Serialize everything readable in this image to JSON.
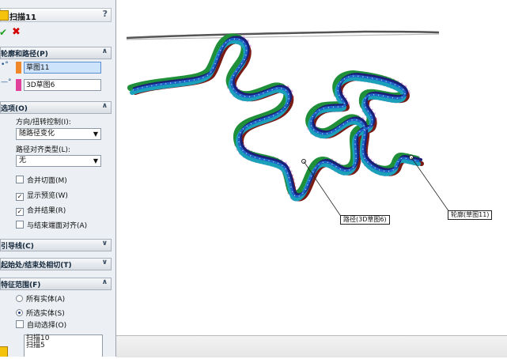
{
  "panel": {
    "title": "扫描11",
    "help": "?",
    "ok": "✔",
    "cancel": "✖",
    "sections": {
      "profile_path": "轮廓和路径(P)",
      "options": "选项(O)",
      "guides": "引导线(C)",
      "tangency": "起始处/结束处相切(T)",
      "scope": "特征范围(F)"
    },
    "profile_field": "草图11",
    "path_field": "3D草图6",
    "twist_label": "方向/扭转控制(I):",
    "twist_value": "随路径变化",
    "align_label": "路径对齐类型(L):",
    "align_value": "无",
    "checkboxes": [
      {
        "label": "合并切面(M)",
        "checked": false
      },
      {
        "label": "显示预览(W)",
        "checked": true
      },
      {
        "label": "合并结果(R)",
        "checked": true
      },
      {
        "label": "与结束端面对齐(A)",
        "checked": false
      }
    ],
    "scope_options": [
      {
        "label": "所有实体(A)",
        "selected": false
      },
      {
        "label": "所选实体(S)",
        "selected": true
      }
    ],
    "auto_select": "自动选择(O)",
    "bodies": [
      "扫描10",
      "扫描5"
    ]
  },
  "graphics": {
    "path_callout": "路径(3D草图6)",
    "profile_callout": "轮廓(草图11)"
  },
  "colors": {
    "rope_dark_red": "#7a1c16",
    "rope_green": "#1f8f3a",
    "rope_blue": "#1e64c8",
    "rope_teal": "#1aa0b8",
    "rope_navy": "#1c1f78",
    "preview_pink": "#e0a0d8",
    "profile_swatch": "#f0882a",
    "path_swatch": "#e0409a"
  }
}
